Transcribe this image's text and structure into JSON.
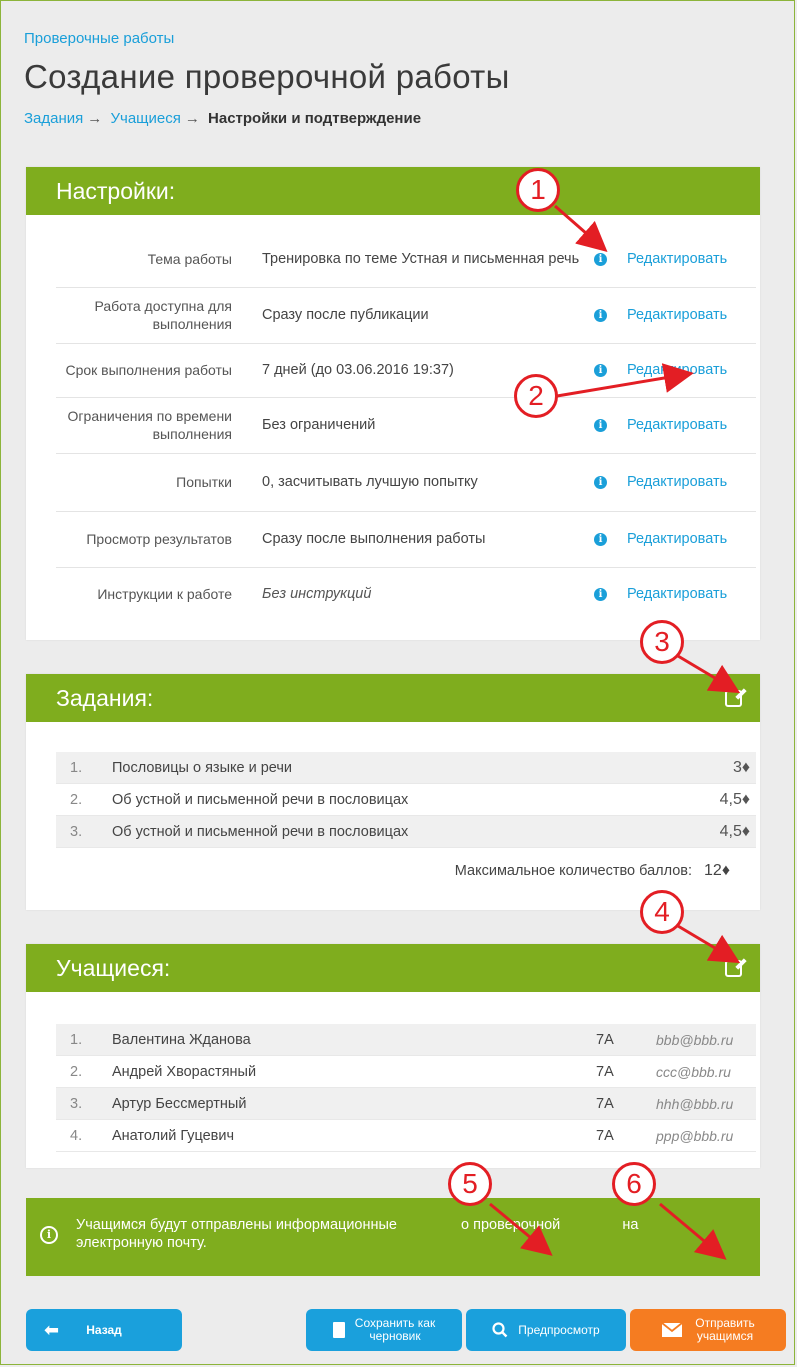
{
  "header": {
    "breadcrumb_link": "Проверочные работы",
    "title": "Создание проверочной работы",
    "steps": {
      "step1": "Задания",
      "step2": "Учащиеся",
      "arrow": "→",
      "current": "Настройки и подтверждение"
    }
  },
  "settings": {
    "title": "Настройки:",
    "rows": [
      {
        "label": "Тема работы",
        "value": "Тренировка по теме Устная и письменная речь",
        "edit": "Редактировать"
      },
      {
        "label": "Работа доступна для выполнения",
        "value": "Сразу после публикации",
        "edit": "Редактировать"
      },
      {
        "label": "Срок выполнения работы",
        "value": "7 дней (до 03.06.2016 19:37)",
        "edit": "Редактировать"
      },
      {
        "label": "Ограничения по времени выполнения",
        "value": "Без ограничений",
        "edit": "Редактировать"
      },
      {
        "label": "Попытки",
        "value": "0, засчитывать лучшую попытку",
        "edit": "Редактировать"
      },
      {
        "label": "Просмотр результатов",
        "value": "Сразу после выполнения работы",
        "edit": "Редактировать"
      },
      {
        "label": "Инструкции к работе",
        "value": "Без инструкций",
        "edit": "Редактировать"
      }
    ]
  },
  "tasks": {
    "title": "Задания:",
    "items": [
      {
        "num": "1.",
        "title": "Пословицы о языке и речи",
        "score": "3♦"
      },
      {
        "num": "2.",
        "title": "Об устной и письменной речи в пословицах",
        "score": "4,5♦"
      },
      {
        "num": "3.",
        "title": "Об устной и письменной речи в пословицах",
        "score": "4,5♦"
      }
    ],
    "max_label": "Максимальное количество баллов:",
    "max_value": "12♦"
  },
  "students": {
    "title": "Учащиеся:",
    "items": [
      {
        "num": "1.",
        "name": "Валентина Жданова",
        "class": "7А",
        "email": "bbb@bbb.ru"
      },
      {
        "num": "2.",
        "name": "Андрей Хворастяный",
        "class": "7А",
        "email": "ccc@bbb.ru"
      },
      {
        "num": "3.",
        "name": "Артур Бессмертный",
        "class": "7А",
        "email": "hhh@bbb.ru"
      },
      {
        "num": "4.",
        "name": "Анатолий Гуцевич",
        "class": "7А",
        "email": "ppp@bbb.ru"
      }
    ]
  },
  "notice": {
    "icon": "i",
    "line1_a": "Учащимся будут отправлены информационные",
    "line1_b": "о проверочной",
    "line1_c": "на",
    "line2": "электронную почту."
  },
  "buttons": {
    "back": "Назад",
    "save_line1": "Сохранить как",
    "save_line2": "черновик",
    "preview": "Предпросмотр",
    "send_line1": "Отправить",
    "send_line2": "учащимся"
  },
  "callouts": [
    "1",
    "2",
    "3",
    "4",
    "5",
    "6"
  ],
  "icons": {
    "info": "info-icon",
    "edit": "edit-icon",
    "back": "arrow-left-icon",
    "save": "document-icon",
    "preview": "search-icon",
    "send": "envelope-icon"
  },
  "colors": {
    "accent_green": "#7fad1e",
    "link_blue": "#1a9fd9",
    "button_blue": "#1aa0dc",
    "button_orange": "#f57c21",
    "callout_red": "#e31e24"
  }
}
